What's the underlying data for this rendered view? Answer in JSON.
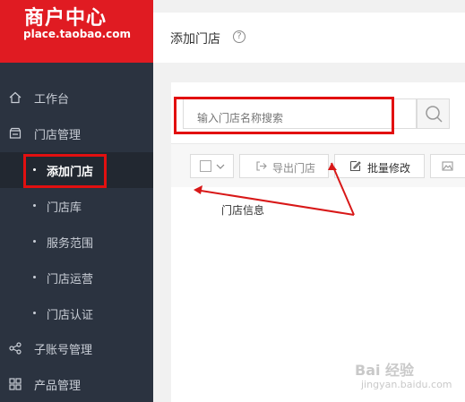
{
  "brand": {
    "title": "商户中心",
    "url": "place.taobao.com"
  },
  "sidebar": {
    "items": [
      {
        "label": "工作台",
        "icon": "home-icon"
      },
      {
        "label": "门店管理",
        "icon": "store-icon"
      },
      {
        "label": "子账号管理",
        "icon": "share-icon"
      },
      {
        "label": "产品管理",
        "icon": "grid-icon"
      }
    ],
    "sub_items": [
      {
        "label": "添加门店",
        "active": true
      },
      {
        "label": "门店库"
      },
      {
        "label": "服务范围"
      },
      {
        "label": "门店运营"
      },
      {
        "label": "门店认证"
      }
    ]
  },
  "header": {
    "title": "添加门店",
    "help": "?"
  },
  "search": {
    "placeholder": "输入门店名称搜索"
  },
  "toolbar": {
    "export_label": "导出门店",
    "batch_edit_label": "批量修改"
  },
  "table": {
    "column_header": "门店信息"
  },
  "watermark": {
    "brand": "Bai 经验",
    "url": "jingyan.baidu.com"
  },
  "colors": {
    "brand_red": "#e01b22",
    "sidebar_bg": "#2b3340",
    "highlight": "#e21010"
  }
}
